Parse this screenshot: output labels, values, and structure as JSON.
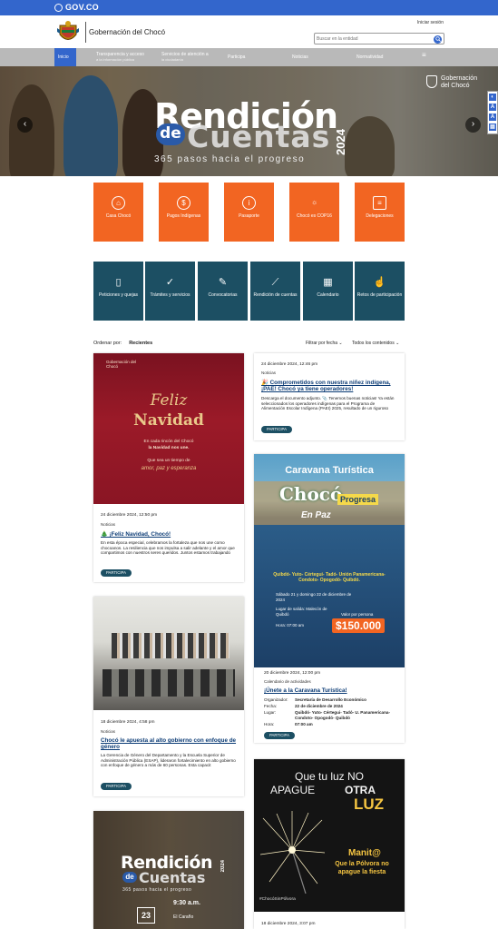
{
  "gov": {
    "brand": "GOV.CO"
  },
  "header": {
    "site_title": "Gobernación del Chocó",
    "login": "Iniciar sesión",
    "search_placeholder": "Buscar en la entidad"
  },
  "nav": {
    "items": [
      {
        "label": "Inicio",
        "sub": ""
      },
      {
        "label": "Transparencia y acceso",
        "sub": "a la información pública"
      },
      {
        "label": "Servicios de atención a",
        "sub": "la ciudadanía"
      },
      {
        "label": "Participa",
        "sub": ""
      },
      {
        "label": "Noticias",
        "sub": ""
      },
      {
        "label": "Normatividad",
        "sub": ""
      },
      {
        "label": "≡",
        "sub": ""
      }
    ]
  },
  "hero": {
    "title_line1": "Rendición",
    "title_de": "de",
    "title_line2": "Cuentas",
    "year": "2024",
    "tagline": "365 pasos hacia el progreso",
    "logo_line1": "Gobernación",
    "logo_line2": "del Chocó"
  },
  "accessibility": [
    "◐",
    "A",
    "A",
    "▤"
  ],
  "orange_tiles": [
    {
      "label": "Casa Chocó",
      "icon": "home-icon",
      "glyph": "⌂"
    },
    {
      "label": "Pagos Indígenas",
      "icon": "dollar-icon",
      "glyph": "$"
    },
    {
      "label": "Pasaporte",
      "icon": "info-icon",
      "glyph": "i"
    },
    {
      "label": "Chocó es COP16",
      "icon": "sun-icon",
      "glyph": "☼"
    },
    {
      "label": "Delegaciones",
      "icon": "document-icon",
      "glyph": "≡"
    }
  ],
  "teal_tiles": [
    {
      "label": "Peticiones y quejas",
      "icon": "document-icon",
      "glyph": "▯"
    },
    {
      "label": "Trámites y servicios",
      "icon": "check-icon",
      "glyph": "✓"
    },
    {
      "label": "Convocatorias",
      "icon": "edit-document-icon",
      "glyph": "✎"
    },
    {
      "label": "Rendición de cuentas",
      "icon": "chart-icon",
      "glyph": "⟋"
    },
    {
      "label": "Calendario",
      "icon": "calendar-icon",
      "glyph": "▦"
    },
    {
      "label": "Retos de participación",
      "icon": "hand-icon",
      "glyph": "☝"
    }
  ],
  "order": {
    "label": "Ordenar por:",
    "value": "Recientes"
  },
  "filters": {
    "date": "Filtrar por fecha",
    "content": "Todos los contenidos"
  },
  "cards": {
    "xmas": {
      "img_title1": "Feliz",
      "img_title2": "Navidad",
      "img_logo": "Gobernación del Chocó",
      "img_text1": "En cada rincón del Chocó",
      "img_text2": "la Navidad nos une.",
      "img_text3": "Que sea un tiempo de",
      "img_text4": "amor, paz y esperanza",
      "date": "24 diciembre 2024, 12:50 pm",
      "category": "Noticias",
      "title": "🎄 ¡Feliz Navidad, Chocó!",
      "text": "En esta época especial, celebramos la fortaleza que nos une como chocoanos. La resiliencia que nos impulsa a salir adelante y el amor que compartimos con nuestros seres queridos. Juntos estamos trabajando",
      "button": "PARTICIPA"
    },
    "pae": {
      "date": "24 diciembre 2024, 12:46 pm",
      "category": "Noticias",
      "title": "🎉 Comprometidos con nuestra niñez indígena, ¡PAE! Chocó ya tiene operadores!",
      "text": "Descarga el documento adjunto. 📎 Tenemos buenas noticias! Ya están seleccionados los operadores indígenas para el Programa de Alimentación Escolar Indígena (PAEI) 2025, resultado de un riguroso",
      "button": "PARTICIPA"
    },
    "caravana": {
      "img_title": "Caravana Turística",
      "img_brand1": "Chocó",
      "img_brand2": "Progresa",
      "img_brand3": "En Paz",
      "img_places": "Quibdó- Yuto- Cértegui- Tadó- Unión Panamericana- Condoto- Opogodó- Quibdó.",
      "img_when": "Sábado 21 y domingo 22 de diciembre de 2024",
      "img_where": "Lugar de salida: Malecón de Quibdó",
      "img_time": "Hora: 07:00 am",
      "img_price_label": "Valor por persona",
      "img_price": "$150.000",
      "date": "20 diciembre 2024, 12:00 pm",
      "category": "Calendario de actividades",
      "title": "¡Únete a la Caravana Turística!",
      "rows": [
        {
          "k": "Organizador:",
          "v": "Secretaría de Desarrollo Económico"
        },
        {
          "k": "Fecha:",
          "v": "22 de diciembre de 2024"
        },
        {
          "k": "Lugar:",
          "v": "Quibdó- Yuto- Cértegui- Tadó- U. Panamericana- Condoto- Opogodó- Quibdó"
        },
        {
          "k": "Hora:",
          "v": "07:00 am"
        }
      ],
      "button": "PARTICIPA"
    },
    "genero": {
      "date": "18 diciembre 2024, 4:58 pm",
      "category": "Noticias",
      "title": "Chocó le apuesta al alto gobierno con enfoque de género",
      "text": "La Gerencia de Género del Departamento y la Escuela Superior de Administración Pública (ESAP), lideraron fortalecimiento en alto gobierno con enfoque de género a más de 60 personas. Esta capacit",
      "button": "PARTICIPA"
    },
    "polvora": {
      "img_line1": "Que tu luz NO",
      "img_line2a": "APAGUE",
      "img_line2b": "OTRA",
      "img_line3": "LUZ",
      "img_brand": "Manit@",
      "img_slogan": "Que la Pólvora no apague la fiesta",
      "img_hashtag": "#ChocóSinPólvora",
      "date": "18 diciembre 2024, 3:07 pm"
    },
    "rendicion": {
      "img_title1": "Rendición",
      "img_title2": "de",
      "img_title3": "Cuentas",
      "img_year": "2024",
      "img_tagline": "365 pasos hacia el progreso",
      "img_time": "9:30 a.m.",
      "img_day": "23",
      "img_place": "El Caraño"
    }
  }
}
